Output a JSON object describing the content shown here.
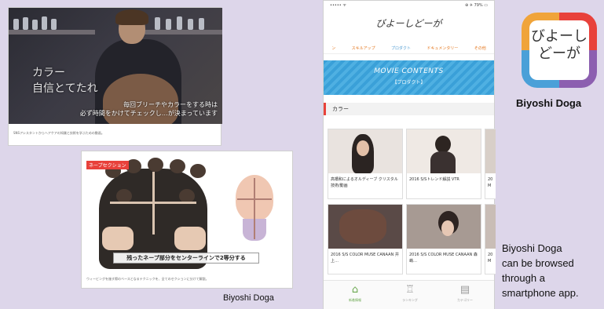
{
  "left_top_card": {
    "overlay_line1": "カラー",
    "overlay_line2": "自信とてたれ",
    "subtitle_line1": "毎回ブリーチやカラーをする時は",
    "subtitle_line2": "必ず時間をかけてチェックし…が決まっています",
    "caption": "SNSアシスタントからヘアケアの知識と技術を学ぶための動画。"
  },
  "left_bottom_card": {
    "tag": "ネープセクション",
    "subtitle": "残ったネープ部分をセンターラインで2等分する",
    "caption": "ウィービングを施す際のベースとなるテクニックを、全てのセクションに分けて解説。"
  },
  "label_left": "Biyoshi Doga",
  "phone": {
    "status_left": "•••••  ᯤ",
    "status_right": "⊕ ✈ 79% ▭",
    "app_title": "びよーしどーが",
    "tabs": [
      {
        "label": "ン",
        "active": false
      },
      {
        "label": "スキルアップ",
        "active": false
      },
      {
        "label": "プロダクト",
        "active": true
      },
      {
        "label": "ドキュメンタリー",
        "active": false
      },
      {
        "label": "その他",
        "active": false
      }
    ],
    "banner_title": "MOVIE CONTENTS",
    "banner_sub": "【プロダクト】",
    "section_title": "カラー",
    "thumbs": [
      {
        "text": "高橋和によるオルディーブ クリスタル技術/動画"
      },
      {
        "text": "2016 S/Sトレンド解説 VTR"
      },
      {
        "text": "2016 S/S COLOR MUSE CANAAN 井上…"
      },
      {
        "text": "2016 S/S COLOR MUSE CANAAN 森嶋…"
      }
    ],
    "partial_labels": [
      "20",
      "M",
      "20",
      "M"
    ],
    "nav": [
      {
        "icon": "home-icon",
        "glyph": "⌂",
        "label": "新着情報",
        "active": true
      },
      {
        "icon": "trophy-icon",
        "glyph": "♖",
        "label": "ランキング",
        "active": false
      },
      {
        "icon": "category-icon",
        "glyph": "▤",
        "label": "カテゴリー",
        "active": false
      }
    ]
  },
  "app_icon": {
    "line1": "びよーし",
    "line2": "どーが"
  },
  "app_name": "Biyoshi Doga",
  "description": {
    "line1": "Biyoshi Doga",
    "line2": "can be browsed",
    "line3": "through a",
    "line4": "smartphone app."
  }
}
